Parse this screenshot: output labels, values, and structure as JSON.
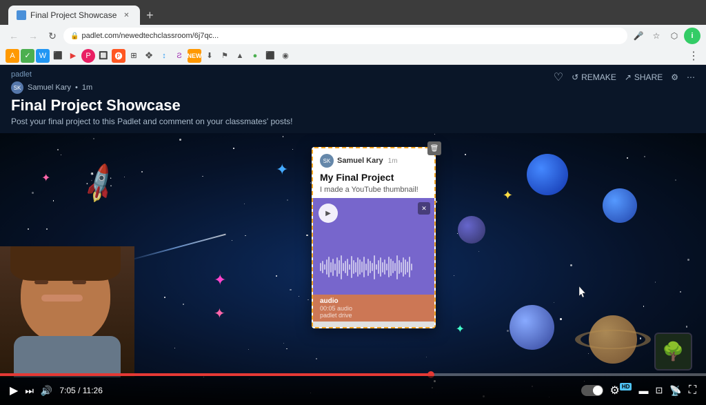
{
  "browser": {
    "tab_title": "Final Project Showcase",
    "url": "padlet.com/newedtechclassroom/6j7qc...",
    "favicon_color": "#4a90d9"
  },
  "padlet": {
    "logo": "padlet",
    "user": "Samuel Kary",
    "time_ago": "1m",
    "title": "Final Project Showcase",
    "subtitle": "Post your final project to this Padlet and comment on your classmates' posts!",
    "actions": {
      "remake": "REMAKE",
      "share": "SHARE"
    }
  },
  "card": {
    "user": "Samuel Kary",
    "time": "1m",
    "title": "My Final Project",
    "description": "I made a YouTube thumbnail!",
    "audio_label": "audio",
    "audio_duration": "00:05 audio",
    "audio_source": "padlet drive"
  },
  "video": {
    "current_time": "7:05",
    "total_time": "11:26",
    "progress_pct": 61
  },
  "icons": {
    "play": "▶",
    "skip": "⏭",
    "volume": "🔊",
    "settings": "⚙",
    "theater": "▬",
    "fullscreen": "⛶",
    "cast": "📺",
    "close": "✕",
    "delete": "🗑",
    "heart": "♡",
    "lock": "🔒"
  }
}
